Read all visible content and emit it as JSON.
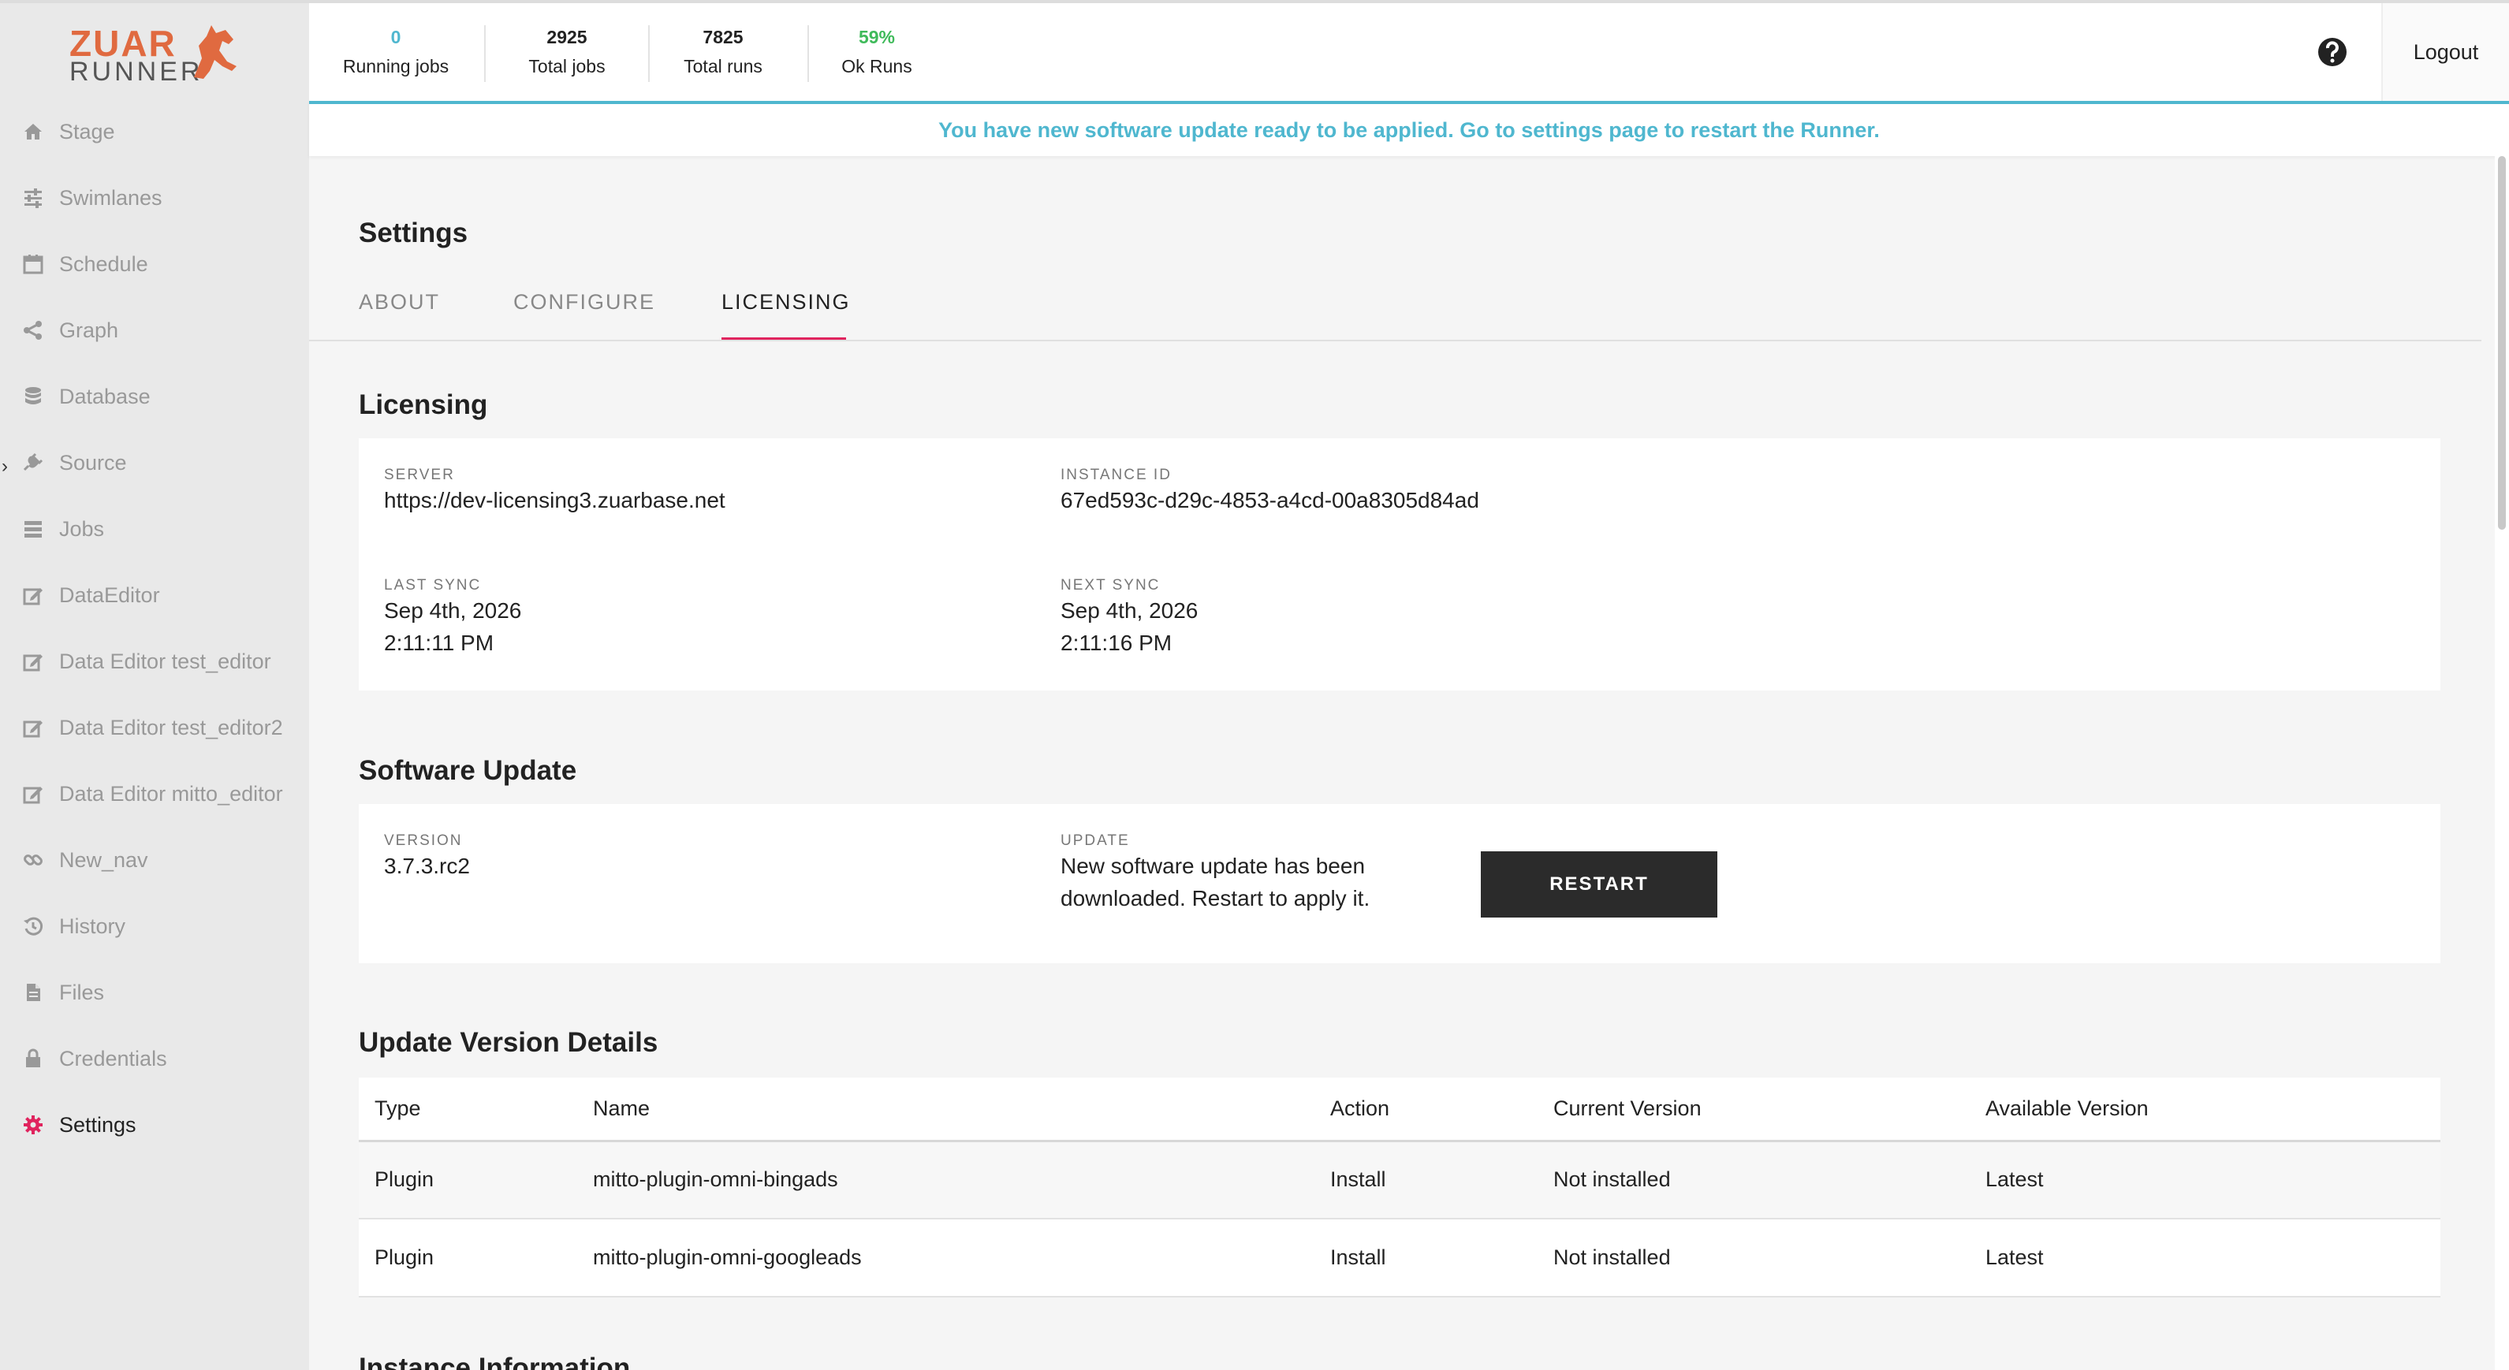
{
  "logo": {
    "line1": "ZUAR",
    "line2": "RUNNER"
  },
  "stats": [
    {
      "value": "0",
      "caption": "Running jobs",
      "color": "#4fb7cf"
    },
    {
      "value": "2925",
      "caption": "Total jobs",
      "color": "#222222"
    },
    {
      "value": "7825",
      "caption": "Total runs",
      "color": "#222222"
    },
    {
      "value": "59%",
      "caption": "Ok Runs",
      "color": "#3fba5a"
    }
  ],
  "header": {
    "logout_label": "Logout",
    "help_icon": "question-circle-icon"
  },
  "banner": "You have new software update ready to be applied. Go to settings page to restart the Runner.",
  "sidebar": {
    "items": [
      {
        "label": "Stage",
        "icon": "home-icon"
      },
      {
        "label": "Swimlanes",
        "icon": "sliders-icon"
      },
      {
        "label": "Schedule",
        "icon": "calendar-icon"
      },
      {
        "label": "Graph",
        "icon": "share-icon"
      },
      {
        "label": "Database",
        "icon": "database-icon"
      },
      {
        "label": "Source",
        "icon": "plug-icon"
      },
      {
        "label": "Jobs",
        "icon": "list-icon"
      },
      {
        "label": "DataEditor",
        "icon": "edit-icon"
      },
      {
        "label": "Data Editor test_editor",
        "icon": "edit-icon"
      },
      {
        "label": "Data Editor test_editor2",
        "icon": "edit-icon"
      },
      {
        "label": "Data Editor mitto_editor",
        "icon": "edit-icon"
      },
      {
        "label": "New_nav",
        "icon": "link-icon"
      },
      {
        "label": "History",
        "icon": "history-icon"
      },
      {
        "label": "Files",
        "icon": "file-icon"
      },
      {
        "label": "Credentials",
        "icon": "lock-icon"
      },
      {
        "label": "Settings",
        "icon": "gear-icon",
        "active": true
      }
    ]
  },
  "page": {
    "title": "Settings",
    "tabs": [
      {
        "label": "ABOUT"
      },
      {
        "label": "CONFIGURE"
      },
      {
        "label": "LICENSING",
        "active": true
      }
    ]
  },
  "licensing": {
    "title": "Licensing",
    "server_label": "SERVER",
    "server": "https://dev-licensing3.zuarbase.net",
    "instance_label": "INSTANCE ID",
    "instance_id": "67ed593c-d29c-4853-a4cd-00a8305d84ad",
    "last_sync_label": "LAST SYNC",
    "last_sync_date": "Sep 4th, 2026",
    "last_sync_time": "2:11:11 PM",
    "next_sync_label": "NEXT SYNC",
    "next_sync_date": "Sep 4th, 2026",
    "next_sync_time": "2:11:16 PM"
  },
  "software_update": {
    "title": "Software Update",
    "version_label": "VERSION",
    "version": "3.7.3.rc2",
    "update_label": "UPDATE",
    "update_line1": "New software update has been",
    "update_line2": "downloaded. Restart to apply it.",
    "restart_label": "RESTART"
  },
  "update_details": {
    "title": "Update Version Details",
    "columns": [
      "Type",
      "Name",
      "Action",
      "Current Version",
      "Available Version"
    ],
    "rows": [
      [
        "Plugin",
        "mitto-plugin-omni-bingads",
        "Install",
        "Not installed",
        "Latest"
      ],
      [
        "Plugin",
        "mitto-plugin-omni-googleads",
        "Install",
        "Not installed",
        "Latest"
      ]
    ]
  },
  "next_section_title": "Instance Information"
}
